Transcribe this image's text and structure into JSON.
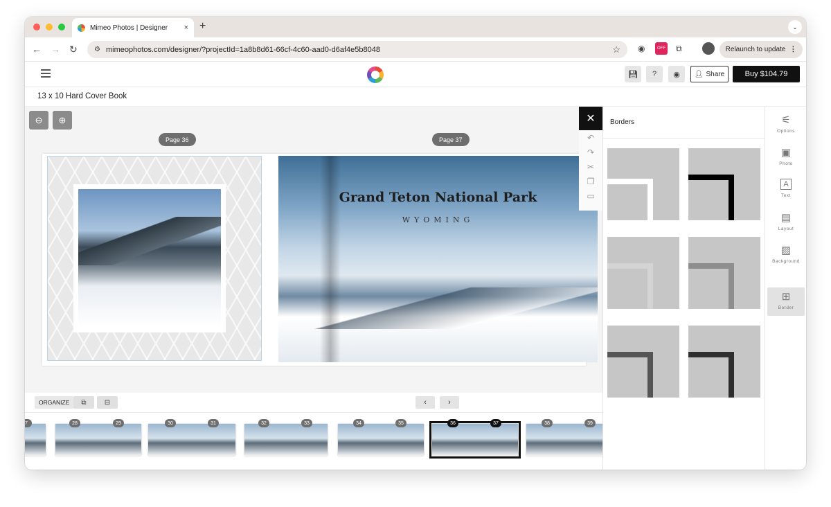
{
  "browser": {
    "tab_title": "Mimeo Photos | Designer",
    "tab_close": "×",
    "new_tab": "+",
    "tab_dropdown": "⌄",
    "url": "mimeophotos.com/designer/?projectId=1a8b8d61-66cf-4c60-aad0-d6af4e5b8048",
    "relaunch_label": "Relaunch to update",
    "relaunch_menu": "⋮",
    "ext_badge": "OFF",
    "traffic_colors": [
      "#ff5f57",
      "#febc2e",
      "#28c840"
    ]
  },
  "header": {
    "share_label": "Share",
    "buy_label": "Buy $104.79"
  },
  "project": {
    "title": "13 x 10 Hard Cover Book"
  },
  "canvas": {
    "page_left_label": "Page 36",
    "page_right_label": "Page 37",
    "park_title": "Grand Teton National Park",
    "park_subtitle": "WYOMING"
  },
  "controls": {
    "organize_label": "ORGANIZE"
  },
  "filmstrip": {
    "pages": [
      "7",
      "28",
      "29",
      "30",
      "31",
      "32",
      "33",
      "34",
      "35",
      "36",
      "37",
      "38",
      "39"
    ]
  },
  "panel": {
    "title": "Borders"
  },
  "rail": {
    "items": [
      {
        "label": "Options",
        "icon": "⚟"
      },
      {
        "label": "Photo",
        "icon": "▣"
      },
      {
        "label": "Text",
        "icon": "A"
      },
      {
        "label": "Layout",
        "icon": "▤"
      },
      {
        "label": "Background",
        "icon": "▨"
      },
      {
        "label": "Border",
        "icon": "⊞"
      }
    ]
  },
  "colors": {
    "accent": "#111111",
    "tile_gray": "#c6c6c6"
  }
}
